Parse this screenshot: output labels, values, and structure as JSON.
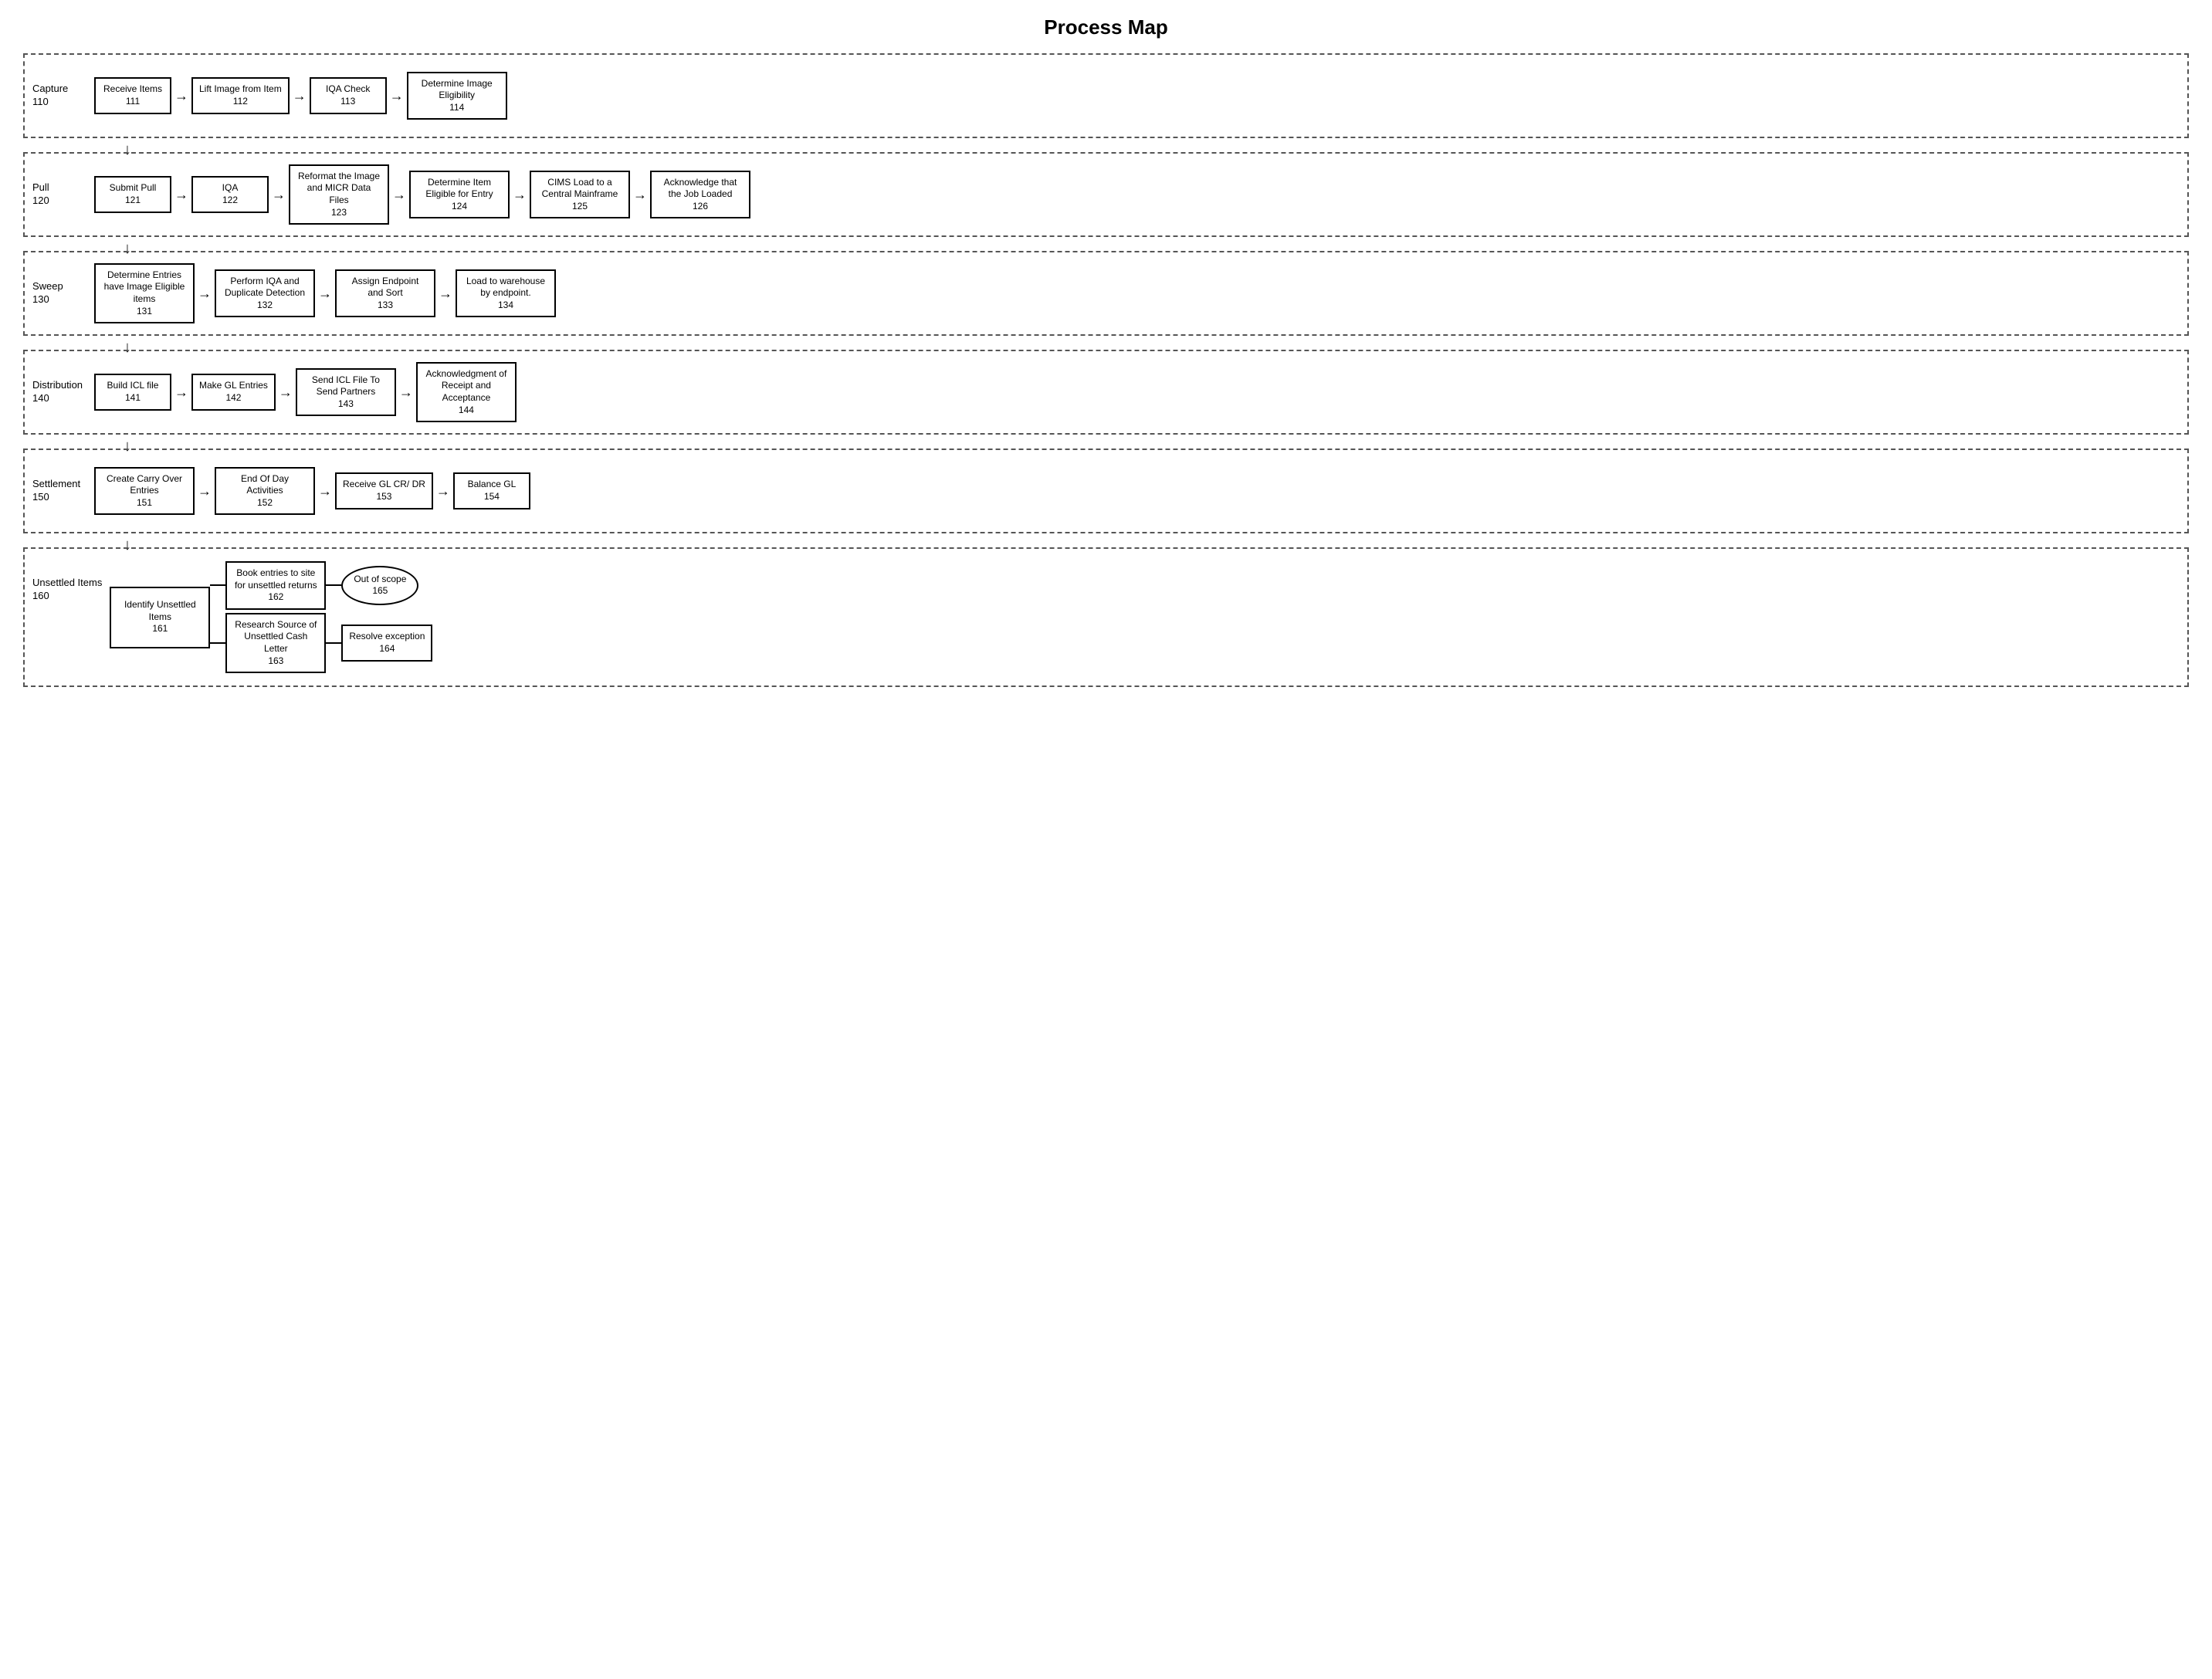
{
  "title": "Process Map",
  "lanes": [
    {
      "id": "capture",
      "label_name": "Capture",
      "label_num": "110",
      "steps": [
        {
          "title": "Receive Items",
          "num": "111"
        },
        {
          "title": "Lift Image from Item",
          "num": "112"
        },
        {
          "title": "IQA Check",
          "num": "113"
        },
        {
          "title": "Determine Image Eligibility",
          "num": "114"
        }
      ]
    },
    {
      "id": "pull",
      "label_name": "Pull",
      "label_num": "120",
      "steps": [
        {
          "title": "Submit Pull",
          "num": "121"
        },
        {
          "title": "IQA",
          "num": "122"
        },
        {
          "title": "Reformat the Image and MICR Data Files",
          "num": "123"
        },
        {
          "title": "Determine Item Eligible for Entry",
          "num": "124"
        },
        {
          "title": "CIMS Load to a Central Mainframe",
          "num": "125"
        },
        {
          "title": "Acknowledge that the Job Loaded",
          "num": "126"
        }
      ]
    },
    {
      "id": "sweep",
      "label_name": "Sweep",
      "label_num": "130",
      "steps": [
        {
          "title": "Determine Entries have Image Eligible items",
          "num": "131"
        },
        {
          "title": "Perform IQA and Duplicate Detection",
          "num": "132"
        },
        {
          "title": "Assign Endpoint and Sort",
          "num": "133"
        },
        {
          "title": "Load to warehouse by endpoint.",
          "num": "134"
        }
      ]
    },
    {
      "id": "distribution",
      "label_name": "Distribution",
      "label_num": "140",
      "steps": [
        {
          "title": "Build ICL file",
          "num": "141"
        },
        {
          "title": "Make GL Entries",
          "num": "142"
        },
        {
          "title": "Send ICL File To Send Partners",
          "num": "143"
        },
        {
          "title": "Acknowledgment of Receipt and Acceptance",
          "num": "144"
        }
      ]
    },
    {
      "id": "settlement",
      "label_name": "Settlement",
      "label_num": "150",
      "steps": [
        {
          "title": "Create Carry Over Entries",
          "num": "151"
        },
        {
          "title": "End Of Day Activities",
          "num": "152"
        },
        {
          "title": "Receive GL CR/ DR",
          "num": "153"
        },
        {
          "title": "Balance GL",
          "num": "154"
        }
      ]
    },
    {
      "id": "unsettled",
      "label_name": "Unsettled Items",
      "label_num": "160",
      "identify": {
        "title": "Identify Unsettled Items",
        "num": "161"
      },
      "branch_top": {
        "title": "Book entries to site for unsettled returns",
        "num": "162"
      },
      "branch_bottom": {
        "title": "Research Source of Unsettled Cash Letter",
        "num": "163"
      },
      "resolve": {
        "title": "Resolve exception",
        "num": "164"
      },
      "out_of_scope": {
        "title": "Out of scope",
        "num": "165"
      }
    }
  ],
  "arrows": {
    "right": "→",
    "down": "↓"
  }
}
